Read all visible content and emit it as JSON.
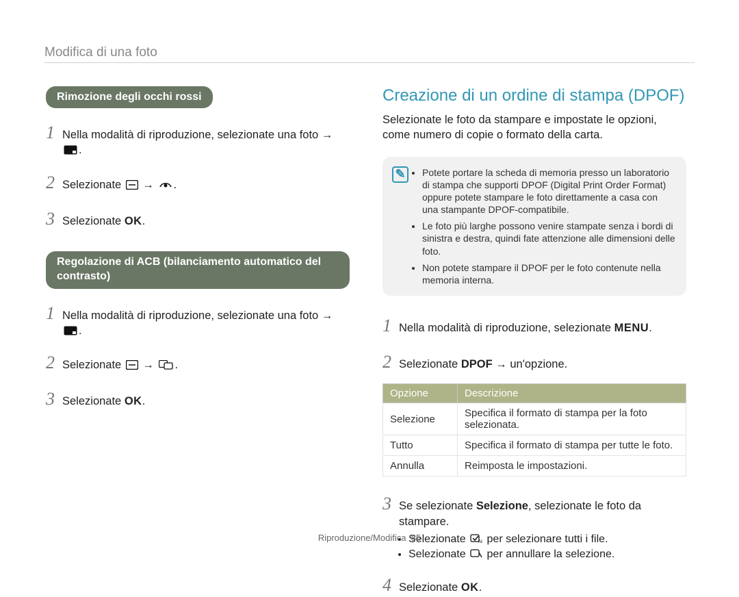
{
  "breadcrumb": "Modifica di una foto",
  "left": {
    "redeye_heading": "Rimozione degli occhi rossi",
    "redeye_steps": [
      {
        "prefix": "Nella modalità di riproduzione, selezionate una foto",
        "arrow1": "→",
        "icon1": "edit-icon",
        "suffix": "."
      },
      {
        "prefix": "Selezionate",
        "icon1": "tool-icon",
        "arrow1": "→",
        "icon2": "redeye-icon",
        "suffix": "."
      },
      {
        "prefix": "Selezionate",
        "ok": "OK",
        "suffix": "."
      }
    ],
    "acb_heading": "Regolazione di ACB (bilanciamento automatico del contrasto)",
    "acb_steps": [
      {
        "prefix": "Nella modalità di riproduzione, selezionate una foto",
        "arrow1": "→",
        "icon1": "edit-icon",
        "suffix": "."
      },
      {
        "prefix": "Selezionate",
        "icon1": "tool-icon",
        "arrow1": "→",
        "icon2": "acb-icon",
        "suffix": "."
      },
      {
        "prefix": "Selezionate",
        "ok": "OK",
        "suffix": "."
      }
    ]
  },
  "right": {
    "title": "Creazione di un ordine di stampa (DPOF)",
    "lead": "Selezionate le foto da stampare e impostate le opzioni, come numero di copie o formato della carta.",
    "notes": [
      "Potete portare la scheda di memoria presso un laboratorio di stampa che supporti DPOF (Digital Print Order Format) oppure potete stampare le foto direttamente a casa con una stampante DPOF-compatibile.",
      "Le foto più larghe possono venire stampate senza i bordi di sinistra e destra, quindi fate attenzione alle dimensioni delle foto.",
      "Non potete stampare il DPOF per le foto contenute nella memoria interna."
    ],
    "steps": {
      "s1": {
        "prefix": "Nella modalità di riproduzione, selezionate",
        "menu": "MENU",
        "suffix": "."
      },
      "s2": {
        "prefix": "Selezionate",
        "strong": "DPOF",
        "arrow": "→",
        "suffix": "un'opzione."
      },
      "s3": {
        "prefix": "Se selezionate",
        "strong": "Selezione",
        "suffix": ", selezionate le foto da stampare."
      },
      "s4": {
        "prefix": "Selezionate",
        "ok": "OK",
        "suffix": "."
      }
    },
    "sub_bullets": {
      "b1": {
        "prefix": "Selezionate",
        "icon": "select-all-icon",
        "suffix": "per selezionare tutti i file."
      },
      "b2": {
        "prefix": "Selezionate",
        "icon": "deselect-icon",
        "suffix": "per annullare la selezione."
      }
    },
    "table": {
      "header_option": "Opzione",
      "header_desc": "Descrizione",
      "rows": [
        {
          "opt": "Selezione",
          "desc": "Specifica il formato di stampa per la foto selezionata."
        },
        {
          "opt": "Tutto",
          "desc": "Specifica il formato di stampa per tutte le foto."
        },
        {
          "opt": "Annulla",
          "desc": "Reimposta le impostazioni."
        }
      ]
    }
  },
  "footer": {
    "section": "Riproduzione/Modifica",
    "page": "85"
  }
}
